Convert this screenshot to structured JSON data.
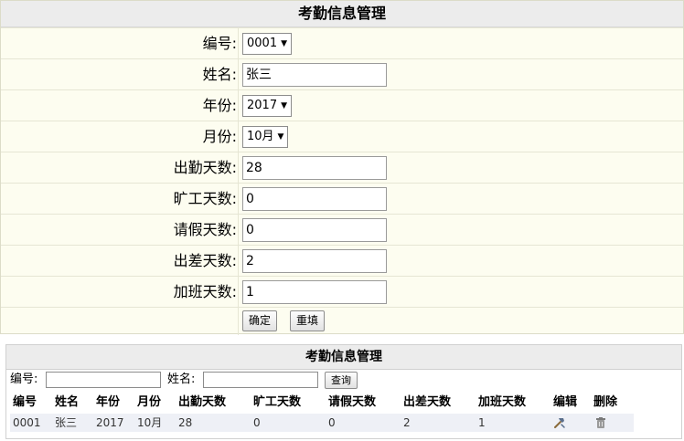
{
  "form": {
    "title": "考勤信息管理",
    "fields": [
      {
        "label": "编号:",
        "type": "select",
        "value": "0001"
      },
      {
        "label": "姓名:",
        "type": "input",
        "value": "张三"
      },
      {
        "label": "年份:",
        "type": "select",
        "value": "2017"
      },
      {
        "label": "月份:",
        "type": "select",
        "value": "10月"
      },
      {
        "label": "出勤天数:",
        "type": "input",
        "value": "28"
      },
      {
        "label": "旷工天数:",
        "type": "input",
        "value": "0"
      },
      {
        "label": "请假天数:",
        "type": "input",
        "value": "0"
      },
      {
        "label": "出差天数:",
        "type": "input",
        "value": "2"
      },
      {
        "label": "加班天数:",
        "type": "input",
        "value": "1"
      }
    ],
    "confirm_label": "确定",
    "reset_label": "重填"
  },
  "list": {
    "title": "考勤信息管理",
    "search": {
      "id_label": "编号:",
      "name_label": "姓名:",
      "id_value": "",
      "name_value": "",
      "button_label": "查询"
    },
    "columns": [
      "编号",
      "姓名",
      "年份",
      "月份",
      "出勤天数",
      "旷工天数",
      "请假天数",
      "出差天数",
      "加班天数",
      "编辑",
      "删除"
    ],
    "rows": [
      {
        "id": "0001",
        "name": "张三",
        "year": "2017",
        "month": "10月",
        "attendance": "28",
        "absent": "0",
        "leave": "0",
        "business_trip": "2",
        "overtime": "1",
        "edit_icon": "hammer-icon",
        "delete_icon": "trash-icon"
      }
    ]
  }
}
